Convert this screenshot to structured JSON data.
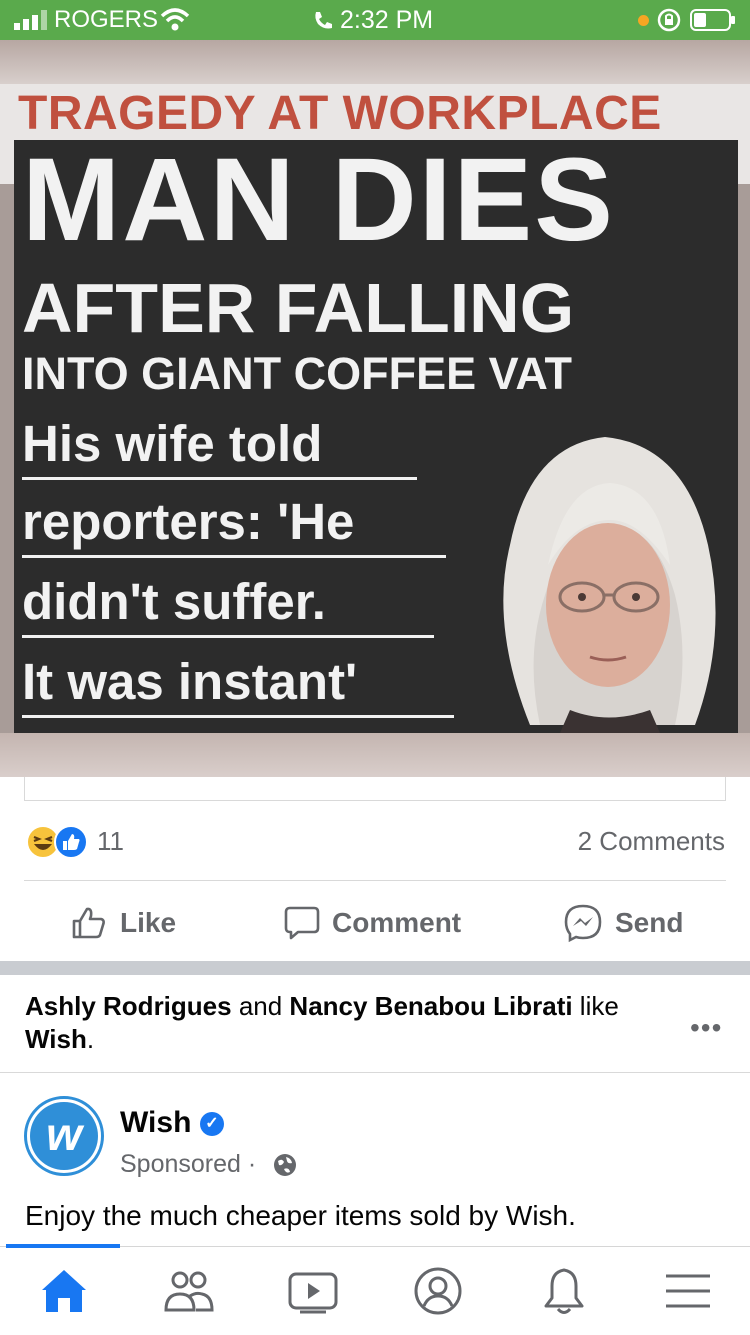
{
  "status_bar": {
    "carrier": "ROGERS",
    "time": "2:32 PM"
  },
  "meme": {
    "kicker": "TRAGEDY AT WORKPLACE",
    "line1": "MAN DIES",
    "line2": "AFTER FALLING",
    "line3": "INTO GIANT COFFEE VAT",
    "quote_lines": [
      "His wife told",
      "reporters: 'He",
      "didn't suffer.",
      "It was instant'"
    ]
  },
  "post": {
    "reaction_count": "11",
    "comments": "2 Comments",
    "actions": {
      "like": "Like",
      "comment": "Comment",
      "send": "Send"
    }
  },
  "suggested": {
    "name1": "Ashly Rodrigues",
    "and": " and ",
    "name2": "Nancy Benabou Librati",
    "like_text": " like ",
    "page": "Wish",
    "period": ".",
    "more": "•••"
  },
  "ad": {
    "brand": "Wish",
    "logo_letter": "w",
    "sponsored": "Sponsored ·",
    "body": "Enjoy the much cheaper items sold by Wish."
  },
  "tabs": [
    "home-icon",
    "friends-icon",
    "watch-icon",
    "profile-icon",
    "notifications-icon",
    "menu-icon"
  ],
  "colors": {
    "status_green": "#5aaa4c",
    "accent": "#1877f2",
    "wish_blue": "#2f8fd8"
  }
}
